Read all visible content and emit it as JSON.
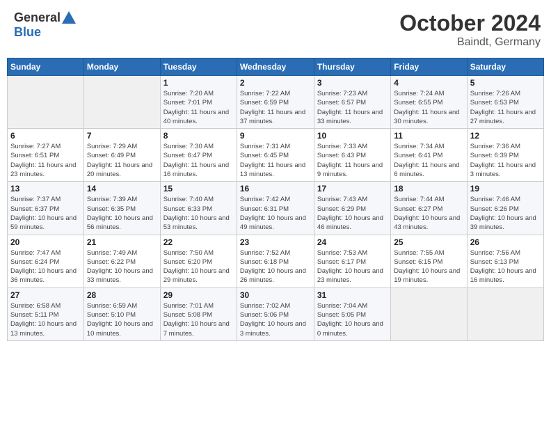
{
  "header": {
    "logo_general": "General",
    "logo_blue": "Blue",
    "month": "October 2024",
    "location": "Baindt, Germany"
  },
  "weekdays": [
    "Sunday",
    "Monday",
    "Tuesday",
    "Wednesday",
    "Thursday",
    "Friday",
    "Saturday"
  ],
  "weeks": [
    [
      {
        "day": "",
        "info": ""
      },
      {
        "day": "",
        "info": ""
      },
      {
        "day": "1",
        "info": "Sunrise: 7:20 AM\nSunset: 7:01 PM\nDaylight: 11 hours and 40 minutes."
      },
      {
        "day": "2",
        "info": "Sunrise: 7:22 AM\nSunset: 6:59 PM\nDaylight: 11 hours and 37 minutes."
      },
      {
        "day": "3",
        "info": "Sunrise: 7:23 AM\nSunset: 6:57 PM\nDaylight: 11 hours and 33 minutes."
      },
      {
        "day": "4",
        "info": "Sunrise: 7:24 AM\nSunset: 6:55 PM\nDaylight: 11 hours and 30 minutes."
      },
      {
        "day": "5",
        "info": "Sunrise: 7:26 AM\nSunset: 6:53 PM\nDaylight: 11 hours and 27 minutes."
      }
    ],
    [
      {
        "day": "6",
        "info": "Sunrise: 7:27 AM\nSunset: 6:51 PM\nDaylight: 11 hours and 23 minutes."
      },
      {
        "day": "7",
        "info": "Sunrise: 7:29 AM\nSunset: 6:49 PM\nDaylight: 11 hours and 20 minutes."
      },
      {
        "day": "8",
        "info": "Sunrise: 7:30 AM\nSunset: 6:47 PM\nDaylight: 11 hours and 16 minutes."
      },
      {
        "day": "9",
        "info": "Sunrise: 7:31 AM\nSunset: 6:45 PM\nDaylight: 11 hours and 13 minutes."
      },
      {
        "day": "10",
        "info": "Sunrise: 7:33 AM\nSunset: 6:43 PM\nDaylight: 11 hours and 9 minutes."
      },
      {
        "day": "11",
        "info": "Sunrise: 7:34 AM\nSunset: 6:41 PM\nDaylight: 11 hours and 6 minutes."
      },
      {
        "day": "12",
        "info": "Sunrise: 7:36 AM\nSunset: 6:39 PM\nDaylight: 11 hours and 3 minutes."
      }
    ],
    [
      {
        "day": "13",
        "info": "Sunrise: 7:37 AM\nSunset: 6:37 PM\nDaylight: 10 hours and 59 minutes."
      },
      {
        "day": "14",
        "info": "Sunrise: 7:39 AM\nSunset: 6:35 PM\nDaylight: 10 hours and 56 minutes."
      },
      {
        "day": "15",
        "info": "Sunrise: 7:40 AM\nSunset: 6:33 PM\nDaylight: 10 hours and 53 minutes."
      },
      {
        "day": "16",
        "info": "Sunrise: 7:42 AM\nSunset: 6:31 PM\nDaylight: 10 hours and 49 minutes."
      },
      {
        "day": "17",
        "info": "Sunrise: 7:43 AM\nSunset: 6:29 PM\nDaylight: 10 hours and 46 minutes."
      },
      {
        "day": "18",
        "info": "Sunrise: 7:44 AM\nSunset: 6:27 PM\nDaylight: 10 hours and 43 minutes."
      },
      {
        "day": "19",
        "info": "Sunrise: 7:46 AM\nSunset: 6:26 PM\nDaylight: 10 hours and 39 minutes."
      }
    ],
    [
      {
        "day": "20",
        "info": "Sunrise: 7:47 AM\nSunset: 6:24 PM\nDaylight: 10 hours and 36 minutes."
      },
      {
        "day": "21",
        "info": "Sunrise: 7:49 AM\nSunset: 6:22 PM\nDaylight: 10 hours and 33 minutes."
      },
      {
        "day": "22",
        "info": "Sunrise: 7:50 AM\nSunset: 6:20 PM\nDaylight: 10 hours and 29 minutes."
      },
      {
        "day": "23",
        "info": "Sunrise: 7:52 AM\nSunset: 6:18 PM\nDaylight: 10 hours and 26 minutes."
      },
      {
        "day": "24",
        "info": "Sunrise: 7:53 AM\nSunset: 6:17 PM\nDaylight: 10 hours and 23 minutes."
      },
      {
        "day": "25",
        "info": "Sunrise: 7:55 AM\nSunset: 6:15 PM\nDaylight: 10 hours and 19 minutes."
      },
      {
        "day": "26",
        "info": "Sunrise: 7:56 AM\nSunset: 6:13 PM\nDaylight: 10 hours and 16 minutes."
      }
    ],
    [
      {
        "day": "27",
        "info": "Sunrise: 6:58 AM\nSunset: 5:11 PM\nDaylight: 10 hours and 13 minutes."
      },
      {
        "day": "28",
        "info": "Sunrise: 6:59 AM\nSunset: 5:10 PM\nDaylight: 10 hours and 10 minutes."
      },
      {
        "day": "29",
        "info": "Sunrise: 7:01 AM\nSunset: 5:08 PM\nDaylight: 10 hours and 7 minutes."
      },
      {
        "day": "30",
        "info": "Sunrise: 7:02 AM\nSunset: 5:06 PM\nDaylight: 10 hours and 3 minutes."
      },
      {
        "day": "31",
        "info": "Sunrise: 7:04 AM\nSunset: 5:05 PM\nDaylight: 10 hours and 0 minutes."
      },
      {
        "day": "",
        "info": ""
      },
      {
        "day": "",
        "info": ""
      }
    ]
  ]
}
